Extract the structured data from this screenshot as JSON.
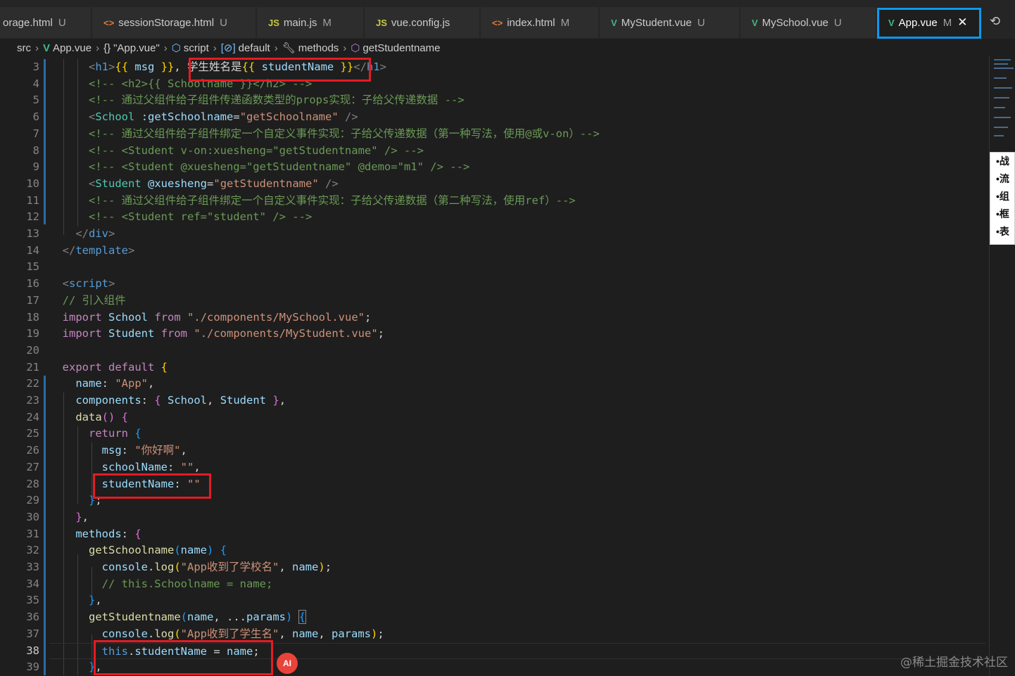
{
  "tabs": [
    {
      "icon": "",
      "label": "orage.html",
      "status": "U"
    },
    {
      "icon": "<>",
      "label": "sessionStorage.html",
      "status": "U"
    },
    {
      "icon": "JS",
      "label": "main.js",
      "status": "M"
    },
    {
      "icon": "JS",
      "label": "vue.config.js",
      "status": ""
    },
    {
      "icon": "<>",
      "label": "index.html",
      "status": "M"
    },
    {
      "icon": "V",
      "label": "MyStudent.vue",
      "status": "U"
    },
    {
      "icon": "V",
      "label": "MySchool.vue",
      "status": "U"
    },
    {
      "icon": "V",
      "label": "App.vue",
      "status": "M"
    }
  ],
  "breadcrumbs": [
    "src",
    "App.vue",
    "\"App.vue\"",
    "script",
    "default",
    "methods",
    "getStudentname"
  ],
  "line_numbers": [
    "3",
    "4",
    "5",
    "6",
    "7",
    "8",
    "9",
    "10",
    "11",
    "12",
    "13",
    "14",
    "15",
    "16",
    "17",
    "18",
    "19",
    "20",
    "21",
    "22",
    "23",
    "24",
    "25",
    "26",
    "27",
    "28",
    "29",
    "30",
    "31",
    "32",
    "33",
    "34",
    "35",
    "36",
    "37",
    "38",
    "39"
  ],
  "current_line": "38",
  "popup_bullets": [
    "•战",
    "•流",
    "•组",
    "•框",
    "•表"
  ],
  "ai_button": "AI",
  "watermark": "@稀土掘金技术社区",
  "colors": {
    "highlight_box": "#e51b23",
    "active_tab_outline": "#0a9af0",
    "editor_bg": "#1e1e1e"
  }
}
